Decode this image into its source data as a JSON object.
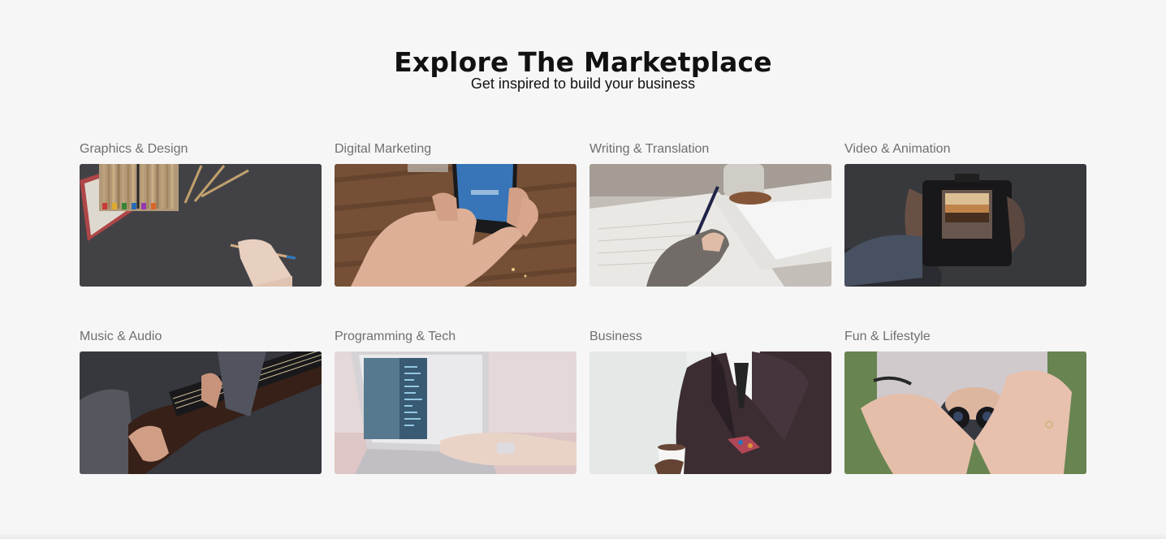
{
  "section": {
    "title": "Explore The Marketplace",
    "subtitle": "Get inspired to build your business"
  },
  "categories": [
    {
      "label": "Graphics & Design",
      "icon": "pencils-drawing-image"
    },
    {
      "label": "Digital Marketing",
      "icon": "smartphone-hand-image"
    },
    {
      "label": "Writing & Translation",
      "icon": "writing-pen-image"
    },
    {
      "label": "Video & Animation",
      "icon": "camera-viewfinder-image"
    },
    {
      "label": "Music & Audio",
      "icon": "guitar-player-image"
    },
    {
      "label": "Programming & Tech",
      "icon": "laptop-code-image"
    },
    {
      "label": "Business",
      "icon": "suit-coffee-image"
    },
    {
      "label": "Fun & Lifestyle",
      "icon": "heart-hands-image"
    }
  ]
}
